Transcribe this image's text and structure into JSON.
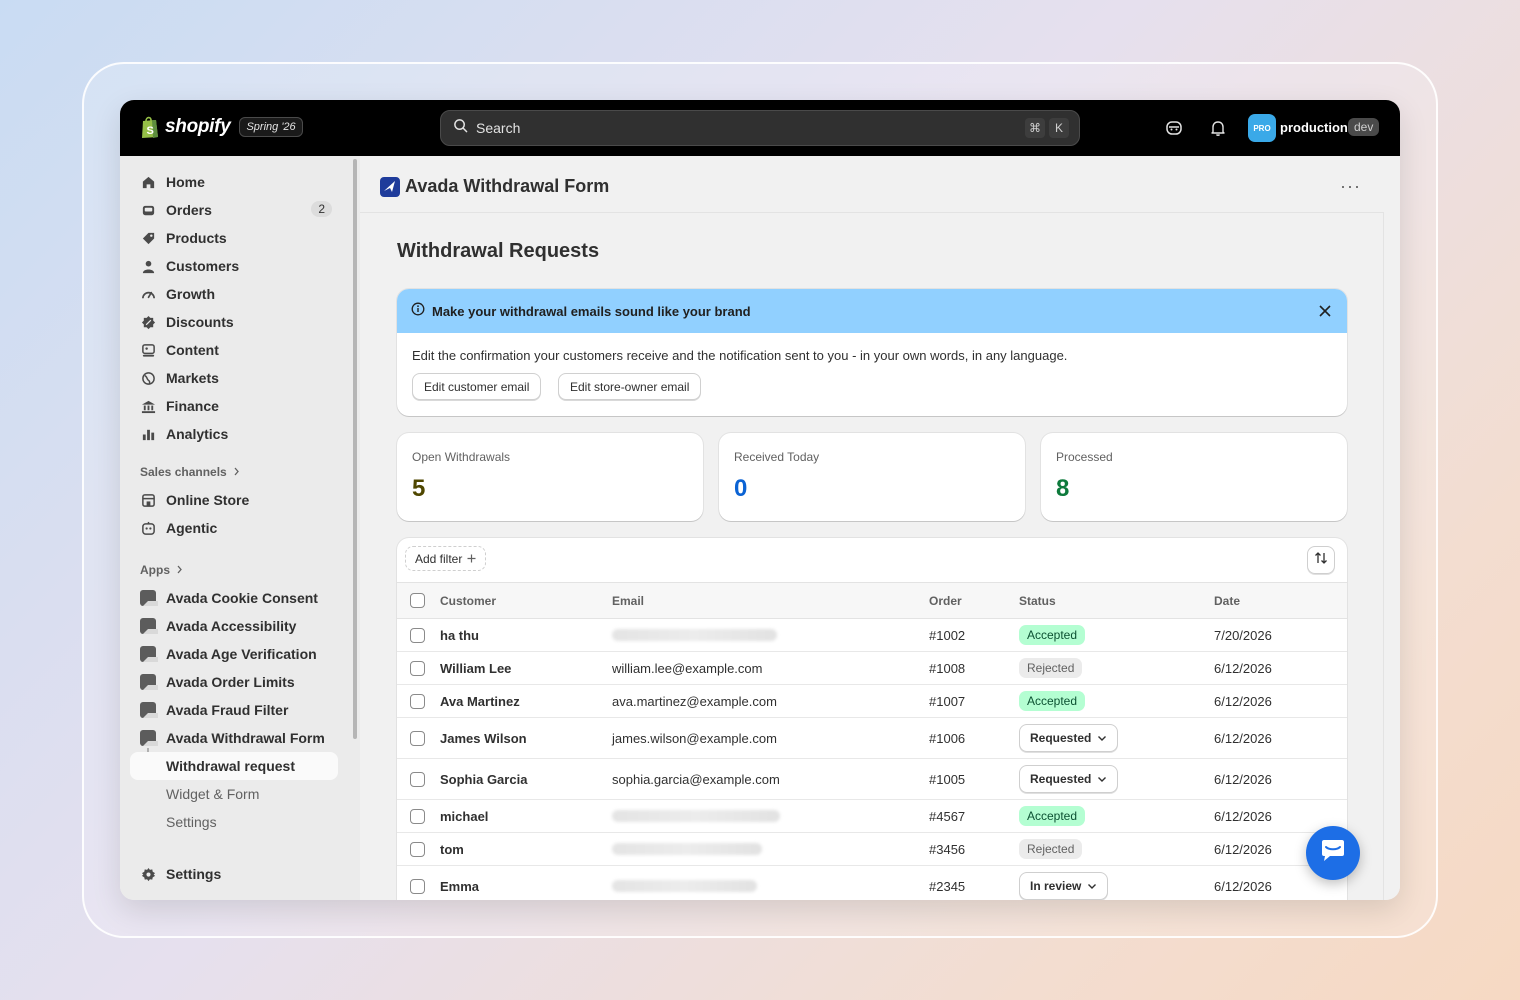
{
  "topbar": {
    "brand": "shopify",
    "season": "Spring '26",
    "search_placeholder": "Search",
    "shortcut_cmd": "⌘",
    "shortcut_key": "K",
    "store_badge": "PRO",
    "store_name": "production",
    "env": "dev"
  },
  "sidebar": {
    "items": [
      {
        "label": "Home",
        "icon": "home-icon"
      },
      {
        "label": "Orders",
        "icon": "orders-icon",
        "count": "2"
      },
      {
        "label": "Products",
        "icon": "tag-icon"
      },
      {
        "label": "Customers",
        "icon": "person-icon"
      },
      {
        "label": "Growth",
        "icon": "gauge-icon"
      },
      {
        "label": "Discounts",
        "icon": "discount-icon"
      },
      {
        "label": "Content",
        "icon": "content-icon"
      },
      {
        "label": "Markets",
        "icon": "globe-icon"
      },
      {
        "label": "Finance",
        "icon": "bank-icon"
      },
      {
        "label": "Analytics",
        "icon": "bar-chart-icon"
      }
    ],
    "sales_channels_heading": "Sales channels",
    "sales_channels": [
      {
        "label": "Online Store",
        "icon": "store-icon"
      },
      {
        "label": "Agentic",
        "icon": "agent-icon"
      }
    ],
    "apps_heading": "Apps",
    "apps": [
      {
        "label": "Avada Cookie Consent"
      },
      {
        "label": "Avada Accessibility"
      },
      {
        "label": "Avada Age Verification"
      },
      {
        "label": "Avada Order Limits"
      },
      {
        "label": "Avada Fraud Filter"
      },
      {
        "label": "Avada Withdrawal Form"
      }
    ],
    "app_subitems": [
      {
        "label": "Withdrawal request"
      },
      {
        "label": "Widget & Form"
      },
      {
        "label": "Settings"
      }
    ],
    "settings_label": "Settings"
  },
  "app": {
    "title": "Avada Withdrawal Form",
    "more_label": "···"
  },
  "page": {
    "title": "Withdrawal Requests"
  },
  "banner": {
    "title": "Make your withdrawal emails sound like your brand",
    "text": "Edit the confirmation your customers receive and the notification sent to you - in your own words, in any language.",
    "button_customer": "Edit customer email",
    "button_owner": "Edit store-owner email"
  },
  "stats": [
    {
      "label": "Open Withdrawals",
      "value": "5",
      "color": "#4f4700"
    },
    {
      "label": "Received Today",
      "value": "0",
      "color": "#0b63d4"
    },
    {
      "label": "Processed",
      "value": "8",
      "color": "#0e7a3c"
    }
  ],
  "table": {
    "add_filter": "Add filter",
    "headers": {
      "customer": "Customer",
      "email": "Email",
      "order": "Order",
      "status": "Status",
      "date": "Date"
    },
    "rows": [
      {
        "customer": "ha thu",
        "email": "",
        "email_hidden": true,
        "order": "#1002",
        "status": "Accepted",
        "status_type": "badge-accepted",
        "date": "7/20/2026"
      },
      {
        "customer": "William Lee",
        "email": "william.lee@example.com",
        "order": "#1008",
        "status": "Rejected",
        "status_type": "badge-rejected",
        "date": "6/12/2026"
      },
      {
        "customer": "Ava Martinez",
        "email": "ava.martinez@example.com",
        "order": "#1007",
        "status": "Accepted",
        "status_type": "badge-accepted",
        "date": "6/12/2026"
      },
      {
        "customer": "James Wilson",
        "email": "james.wilson@example.com",
        "order": "#1006",
        "status": "Requested",
        "status_type": "select",
        "date": "6/12/2026"
      },
      {
        "customer": "Sophia Garcia",
        "email": "sophia.garcia@example.com",
        "order": "#1005",
        "status": "Requested",
        "status_type": "select",
        "date": "6/12/2026"
      },
      {
        "customer": "michael",
        "email": "",
        "email_hidden": true,
        "order": "#4567",
        "status": "Accepted",
        "status_type": "badge-accepted",
        "date": "6/12/2026"
      },
      {
        "customer": "tom",
        "email": "",
        "email_hidden": true,
        "order": "#3456",
        "status": "Rejected",
        "status_type": "badge-rejected",
        "date": "6/12/2026"
      },
      {
        "customer": "Emma",
        "email": "",
        "email_hidden": true,
        "order": "#2345",
        "status": "In review",
        "status_type": "select",
        "date": "6/12/2026"
      }
    ]
  }
}
